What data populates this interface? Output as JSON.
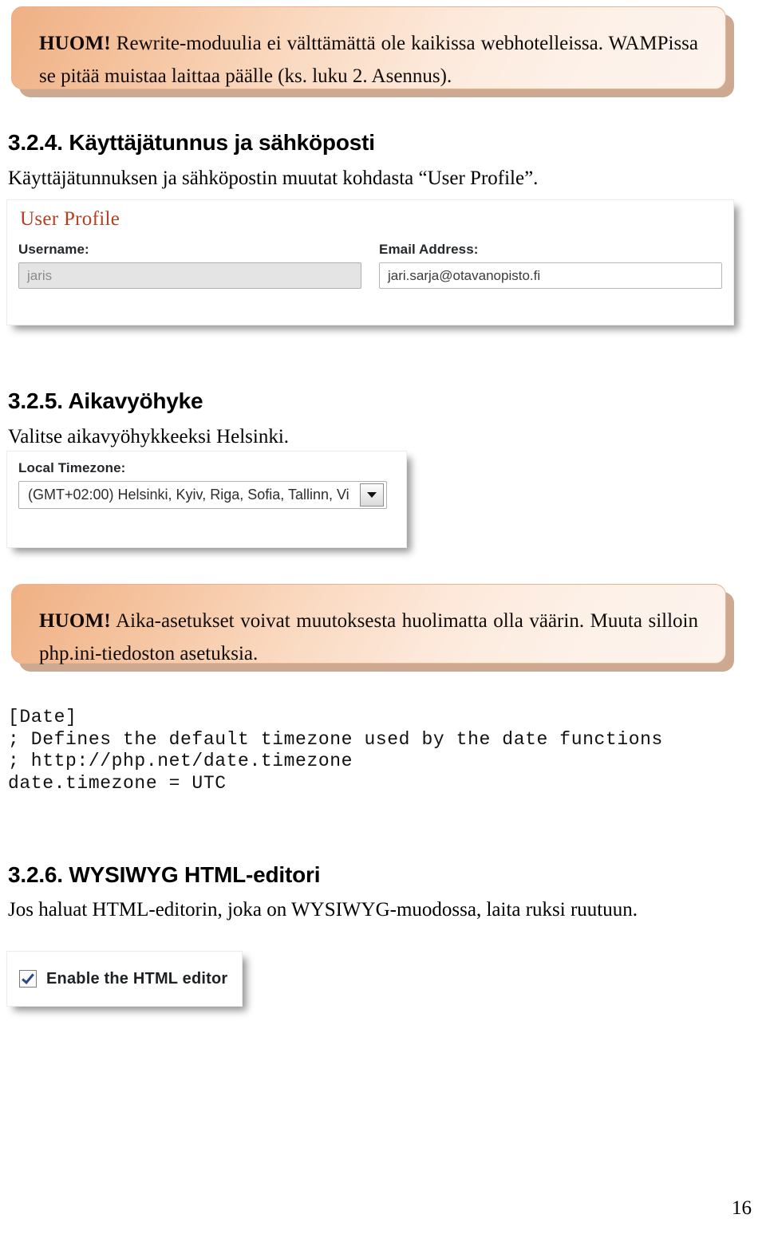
{
  "callouts": [
    {
      "tag": "HUOM!",
      "text": " Rewrite-moduulia ei välttämättä ole kaikissa webhotelleissa. WAMPissa se pitää muistaa laittaa päälle (ks. luku 2. Asennus)."
    },
    {
      "tag": "HUOM!",
      "text": " Aika-asetukset voivat muutoksesta huolimatta olla väärin. Muuta silloin php.ini-tiedoston asetuksia."
    }
  ],
  "sections": {
    "s324": {
      "heading": "3.2.4. Käyttäjätunnus ja sähköposti",
      "paragraph": "Käyttäjätunnuksen ja sähköpostin muutat kohdasta “User Profile”."
    },
    "s325": {
      "heading": "3.2.5. Aikavyöhyke",
      "paragraph": "Valitse aikavyöhykkeeksi Helsinki."
    },
    "s326": {
      "heading": "3.2.6. WYSIWYG HTML-editori",
      "paragraph": "Jos haluat HTML-editorin, joka on WYSIWYG-muodossa, laita ruksi ruutuun."
    }
  },
  "user_profile": {
    "title": "User Profile",
    "username_label": "Username:",
    "username_value": "jaris",
    "email_label": "Email Address:",
    "email_value": "jari.sarja@otavanopisto.fi",
    "title_color": "#b3401f"
  },
  "timezone": {
    "label": "Local Timezone:",
    "selected": "(GMT+02:00) Helsinki, Kyiv, Riga, Sofia, Tallinn, Vi",
    "arrow_icon": "chevron-down-icon"
  },
  "html_editor": {
    "checkbox_label": "Enable the HTML editor",
    "checked": true
  },
  "code_block": "[Date]\n; Defines the default timezone used by the date functions\n; http://php.net/date.timezone\ndate.timezone = UTC",
  "page_number": "16"
}
